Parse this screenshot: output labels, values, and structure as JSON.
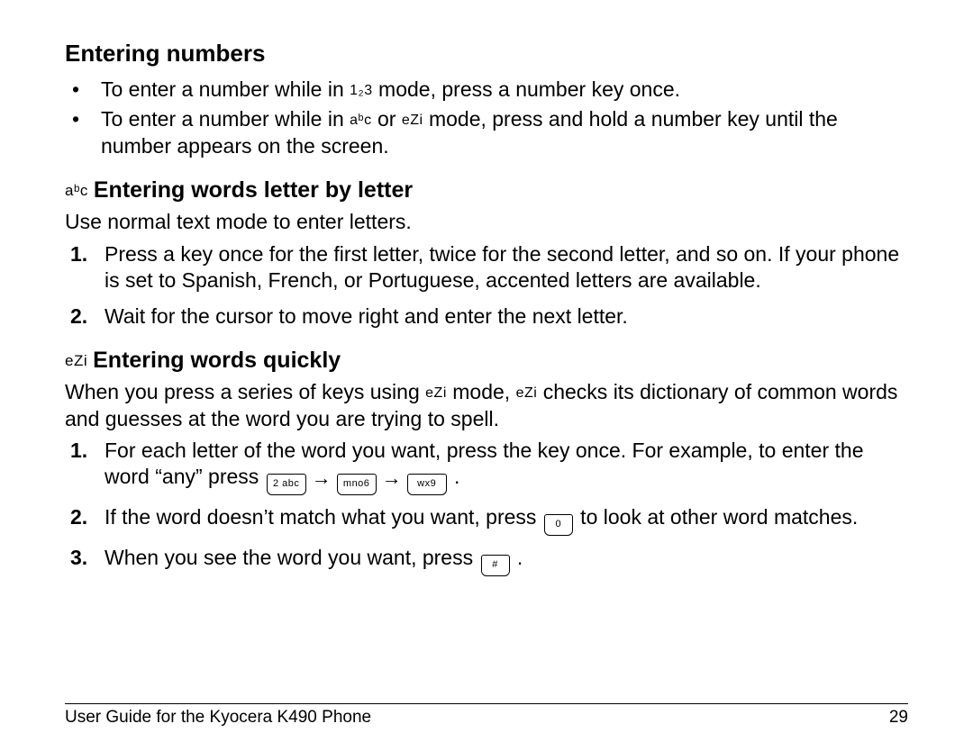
{
  "s1": {
    "title": "Entering numbers",
    "b1a": "To enter a number while in ",
    "b1_mode": "1₂3",
    "b1b": " mode, press a number key once.",
    "b2a": "To enter a number while in ",
    "b2_mode_abc": "aᵇc",
    "b2_or": " or ",
    "b2_mode_ezi": "eZi",
    "b2b": " mode, press and hold a number key until the number appears on the screen."
  },
  "s2": {
    "prefix": "aᵇc",
    "title": "Entering words letter by letter",
    "intro": "Use normal text mode to enter letters.",
    "step1": "Press a key once for the first letter, twice for the second letter, and so on. If your phone is set to Spanish, French, or Portuguese, accented letters are available.",
    "step2": "Wait for the cursor to move right and enter the next letter."
  },
  "s3": {
    "prefix": "eZi",
    "title": "Entering words quickly",
    "intro_a": "When you press a series of keys using ",
    "intro_mode1": "eZi",
    "intro_b": " mode, ",
    "intro_mode2": "eZi",
    "intro_c": " checks its dictionary of common words and guesses at the word you are trying to spell.",
    "step1a": "For each letter of the word you want, press the key once. For example, to enter the word “any” press ",
    "key1": "2 abc",
    "key2": "mno6",
    "key3": "wx9",
    "step1b": " .",
    "step2a": "If the word doesn’t match what you want, press ",
    "key_next": "0",
    "step2b": " to look at other word matches.",
    "step3a": "When you see the word you want, press ",
    "key_hash": "#",
    "step3b": " ."
  },
  "footer": {
    "left": "User Guide for the Kyocera K490 Phone",
    "right": "29"
  }
}
